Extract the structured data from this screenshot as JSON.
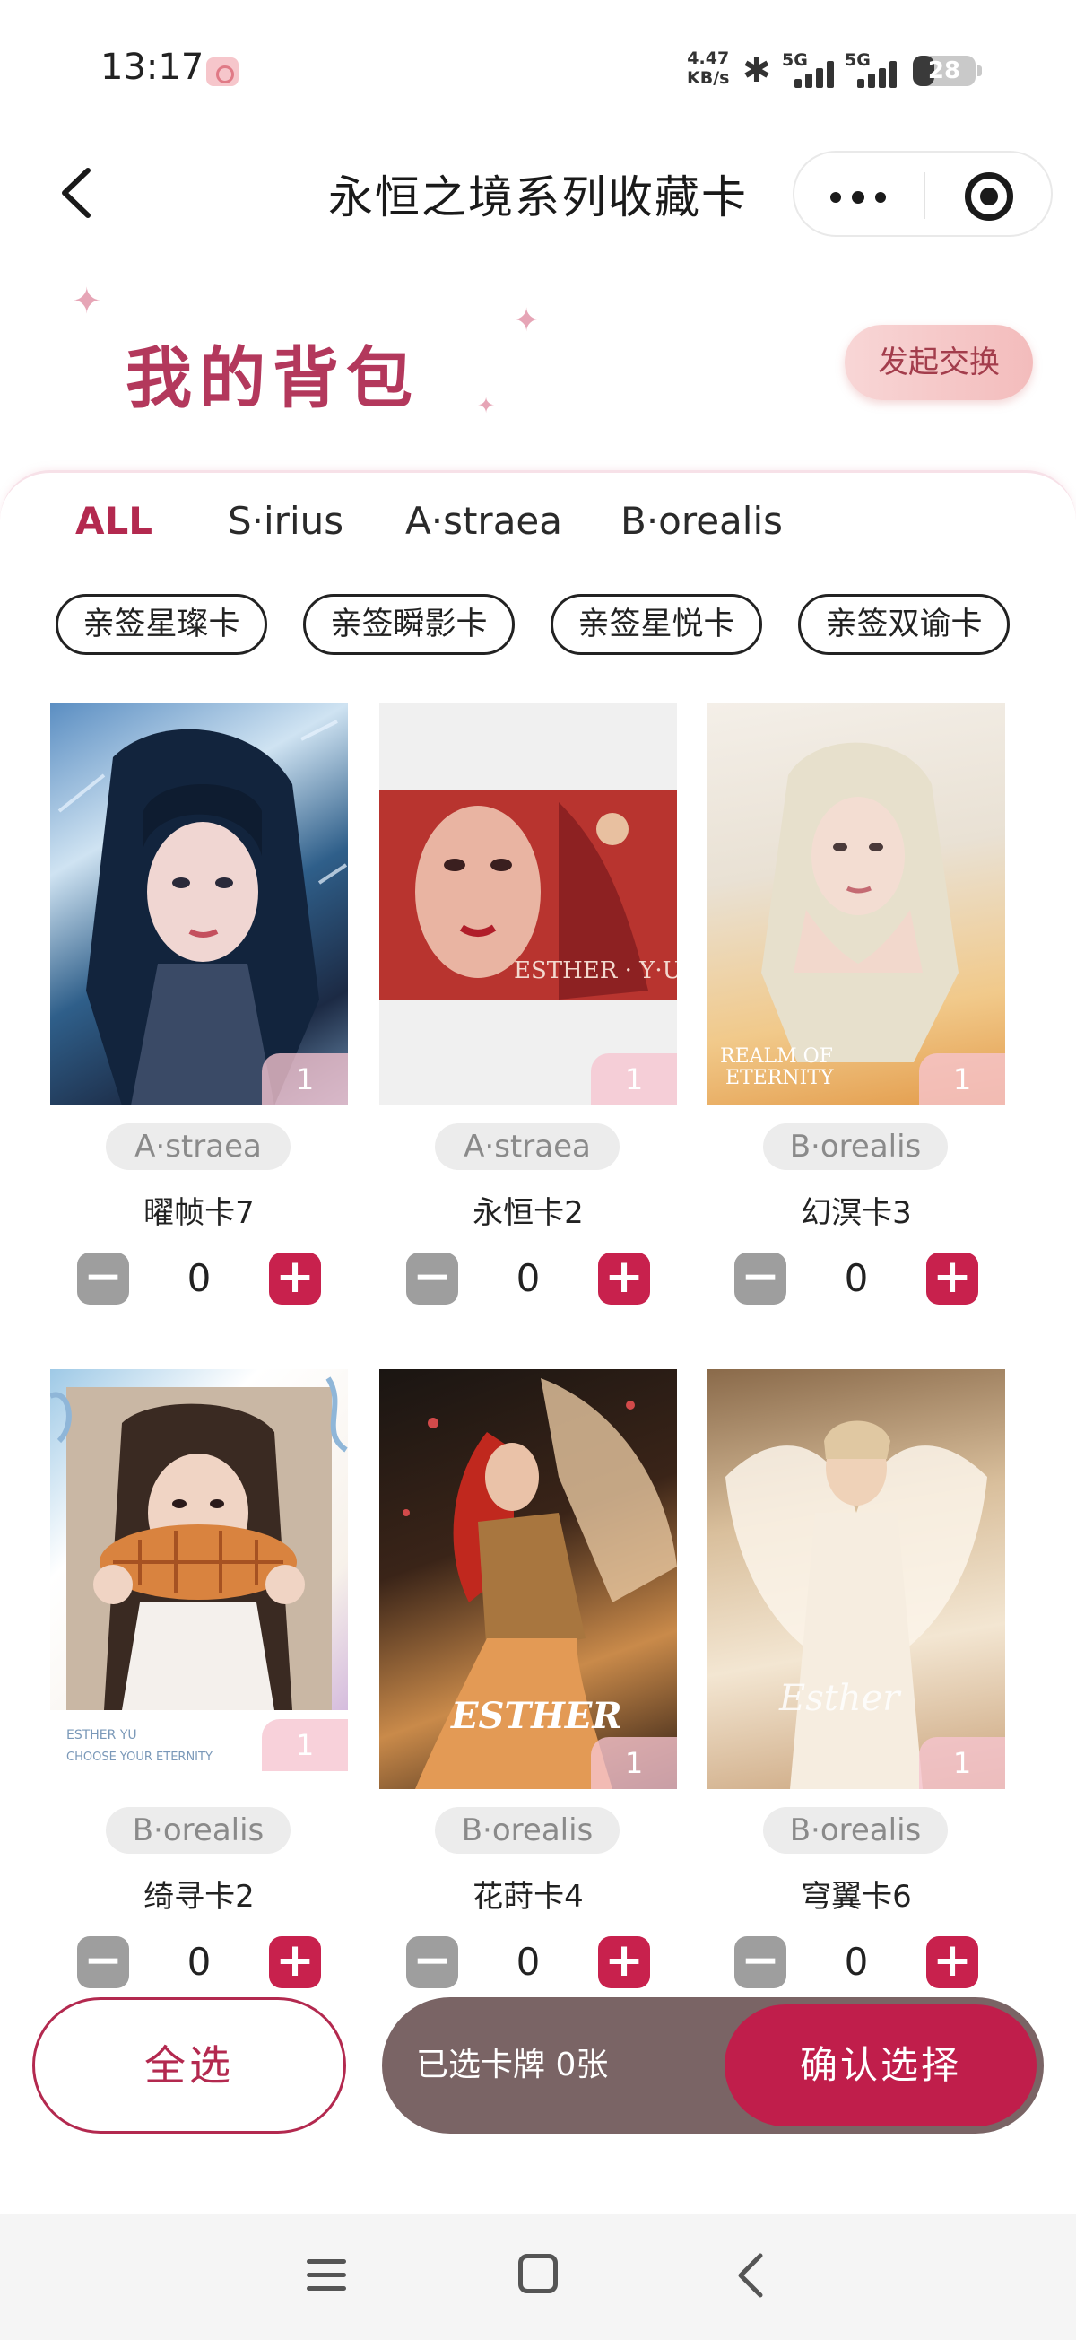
{
  "status_bar": {
    "time": "13:17",
    "net_speed_value": "4.47",
    "net_speed_unit": "KB/s",
    "sim1": "5G",
    "sim2": "5G",
    "battery": "28"
  },
  "nav": {
    "title": "永恒之境系列收藏卡"
  },
  "header": {
    "title": "我的背包",
    "exchange_button": "发起交换"
  },
  "tabs": [
    "ALL",
    "S·irius",
    "A·straea",
    "B·orealis"
  ],
  "active_tab": "ALL",
  "chips": [
    "亲签星璨卡",
    "亲签瞬影卡",
    "亲签星悦卡",
    "亲签双谕卡"
  ],
  "cards": [
    {
      "series": "A·straea",
      "name": "曜帧卡7",
      "count": "1",
      "qty": "0"
    },
    {
      "series": "A·straea",
      "name": "永恒卡2",
      "count": "1",
      "qty": "0"
    },
    {
      "series": "B·orealis",
      "name": "幻溟卡3",
      "count": "1",
      "qty": "0"
    },
    {
      "series": "B·orealis",
      "name": "绮寻卡2",
      "count": "1",
      "qty": "0"
    },
    {
      "series": "B·orealis",
      "name": "花莳卡4",
      "count": "1",
      "qty": "0"
    },
    {
      "series": "B·orealis",
      "name": "穹翼卡6",
      "count": "1",
      "qty": "0"
    }
  ],
  "card_art_text": {
    "card2": "ESTHER · Y·U",
    "card3_line1": "REALM OF",
    "card3_line2": "ETERNITY",
    "card4_line1": "ESTHER YU",
    "card4_line2": "CHOOSE YOUR ETERNITY",
    "card5": "ESTHER",
    "card6": "Esther"
  },
  "bottom": {
    "select_all": "全选",
    "selected_text": "已选卡牌 0张",
    "confirm": "确认选择"
  },
  "colors": {
    "accent": "#c01e4b",
    "title_pink": "#b3385c",
    "minus_gray": "#9e9e9e",
    "bar_brown": "#7a6465"
  }
}
